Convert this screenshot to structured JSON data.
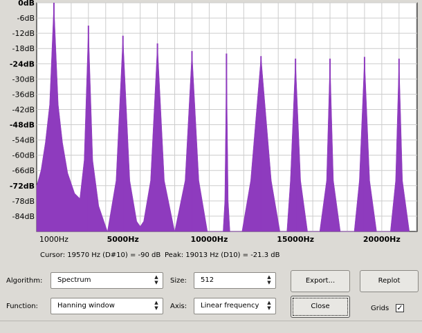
{
  "chart_data": {
    "type": "area",
    "xlabel": "",
    "ylabel": "",
    "x_tick_labels": [
      "1000Hz",
      "5000Hz",
      "10000Hz",
      "15000Hz",
      "20000Hz"
    ],
    "x_tick_values": [
      1000,
      5000,
      10000,
      15000,
      20000
    ],
    "y_tick_labels": [
      "0dB",
      "-6dB",
      "-12dB",
      "-18dB",
      "-24dB",
      "-30dB",
      "-36dB",
      "-42dB",
      "-48dB",
      "-54dB",
      "-60dB",
      "-66dB",
      "-72dB",
      "-78dB",
      "-84dB"
    ],
    "y_tick_values": [
      0,
      -6,
      -12,
      -18,
      -24,
      -30,
      -36,
      -42,
      -48,
      -54,
      -60,
      -66,
      -72,
      -78,
      -84
    ],
    "y_bold_labels": [
      "0dB",
      "-24dB",
      "-48dB",
      "-72dB"
    ],
    "xlim": [
      0,
      22050
    ],
    "ylim": [
      -90,
      0
    ],
    "grid": true,
    "fill_color": "#8e3bbe",
    "series": [
      {
        "peaks": [
          {
            "x": 1000,
            "y": 0
          },
          {
            "x": 3000,
            "y": -9
          },
          {
            "x": 5000,
            "y": -13
          },
          {
            "x": 7000,
            "y": -16
          },
          {
            "x": 9000,
            "y": -19
          },
          {
            "x": 11000,
            "y": -20
          },
          {
            "x": 13000,
            "y": -21
          },
          {
            "x": 15000,
            "y": -22
          },
          {
            "x": 17000,
            "y": -22
          },
          {
            "x": 19000,
            "y": -21.3
          },
          {
            "x": 21000,
            "y": -22
          }
        ],
        "points": [
          [
            0,
            -72
          ],
          [
            250,
            -66
          ],
          [
            500,
            -55
          ],
          [
            750,
            -40
          ],
          [
            1000,
            0
          ],
          [
            1250,
            -40
          ],
          [
            1500,
            -55
          ],
          [
            1800,
            -67
          ],
          [
            2200,
            -75
          ],
          [
            2500,
            -77
          ],
          [
            2750,
            -62
          ],
          [
            3000,
            -9
          ],
          [
            3250,
            -62
          ],
          [
            3600,
            -80
          ],
          [
            4100,
            -90
          ],
          [
            4600,
            -70
          ],
          [
            5000,
            -13
          ],
          [
            5400,
            -70
          ],
          [
            5800,
            -86
          ],
          [
            6000,
            -88
          ],
          [
            6200,
            -86
          ],
          [
            6600,
            -70
          ],
          [
            7000,
            -16
          ],
          [
            7400,
            -70
          ],
          [
            8000,
            -90
          ],
          [
            8600,
            -70
          ],
          [
            9000,
            -19
          ],
          [
            9400,
            -70
          ],
          [
            9900,
            -90
          ],
          [
            10800,
            -90
          ],
          [
            10900,
            -78
          ],
          [
            11000,
            -20
          ],
          [
            11100,
            -78
          ],
          [
            11200,
            -90
          ],
          [
            11900,
            -90
          ],
          [
            12400,
            -70
          ],
          [
            13000,
            -21
          ],
          [
            13600,
            -70
          ],
          [
            14100,
            -90
          ],
          [
            14500,
            -90
          ],
          [
            14700,
            -70
          ],
          [
            15000,
            -22
          ],
          [
            15300,
            -70
          ],
          [
            15700,
            -90
          ],
          [
            16400,
            -90
          ],
          [
            16800,
            -70
          ],
          [
            17000,
            -22
          ],
          [
            17200,
            -70
          ],
          [
            17600,
            -90
          ],
          [
            18400,
            -90
          ],
          [
            18700,
            -70
          ],
          [
            19000,
            -21.3
          ],
          [
            19300,
            -70
          ],
          [
            19700,
            -90
          ],
          [
            20500,
            -90
          ],
          [
            20800,
            -70
          ],
          [
            21000,
            -22
          ],
          [
            21200,
            -70
          ],
          [
            21600,
            -90
          ]
        ]
      }
    ]
  },
  "status": {
    "cursor": "Cursor: 19570 Hz (D#10) = -90 dB",
    "peak": "Peak: 19013 Hz (D10) = -21.3 dB"
  },
  "controls": {
    "algorithm_label": "Algorithm:",
    "algorithm_value": "Spectrum",
    "size_label": "Size:",
    "size_value": "512",
    "function_label": "Function:",
    "function_value": "Hanning window",
    "axis_label": "Axis:",
    "axis_value": "Linear frequency",
    "export_label": "Export...",
    "replot_label": "Replot",
    "close_label": "Close",
    "grids_label": "Grids",
    "grids_checked": true
  }
}
